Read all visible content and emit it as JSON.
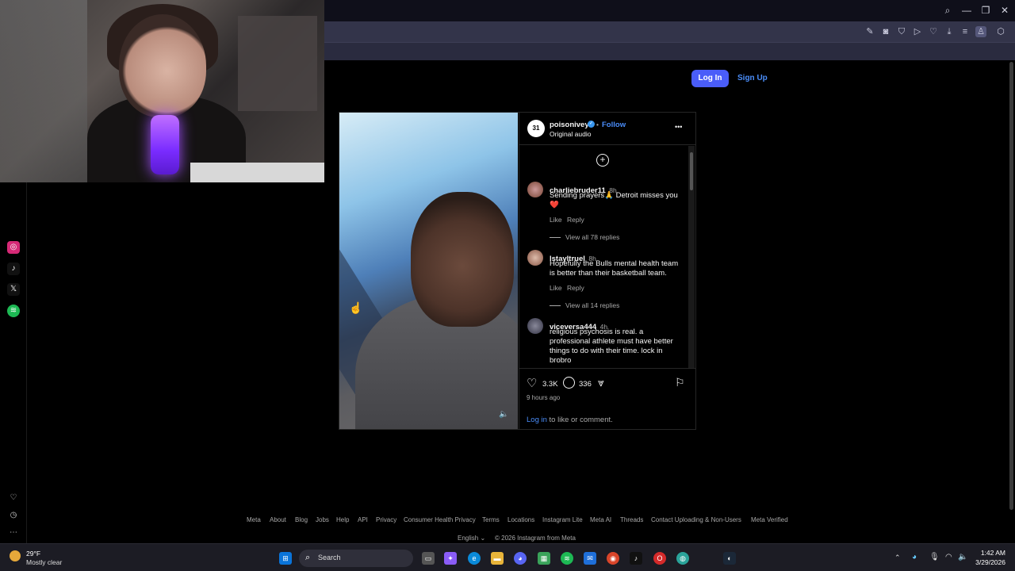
{
  "webcam": {
    "label": "Streamer webcam overlay"
  },
  "browser": {
    "window_controls": [
      "⌕",
      "—",
      "❐",
      "✕"
    ],
    "toolbar_icons": [
      "edit-icon",
      "camera-icon",
      "shield-icon",
      "play-icon",
      "heart-icon",
      "download-icon",
      "menu-icon",
      "profile-icon",
      "extensions-icon"
    ]
  },
  "sidebar": {
    "apps": [
      {
        "name": "instagram",
        "glyph": "◎",
        "color": "#d62976"
      },
      {
        "name": "tiktok",
        "glyph": "♪",
        "color": "#111"
      },
      {
        "name": "x",
        "glyph": "𝕏",
        "color": "#111"
      },
      {
        "name": "spotify",
        "glyph": "≋",
        "color": "#1db954"
      }
    ],
    "bottom": [
      "♡",
      "◷",
      "⋯"
    ]
  },
  "header": {
    "login_label": "Log In",
    "signup_label": "Sign Up"
  },
  "post": {
    "username": "poisonivey",
    "follow_label": "Follow",
    "audio": "Original audio",
    "more": "•••",
    "likes": "3.3K",
    "comments_count": "336",
    "time_ago": "9 hours ago",
    "login_link": "Log in",
    "login_text": " to like or comment.",
    "comments": [
      {
        "user": "charliebruder11",
        "time": "8h",
        "text": "Sending prayers🙏 Detroit misses you ❤️",
        "like": "Like",
        "reply": "Reply",
        "view": "View all 78 replies"
      },
      {
        "user": "lstayltruel",
        "time": "8h",
        "text": "Hopefully the Bulls mental health team is better than their basketball team.",
        "like": "Like",
        "reply": "Reply",
        "view": "View all 14 replies"
      },
      {
        "user": "viceversa444",
        "time": "4h",
        "text": "religious psychosis is real. a professional athlete must have better things to do with their time. lock in brobro"
      }
    ]
  },
  "footer": {
    "links": [
      "Meta",
      "About",
      "Blog",
      "Jobs",
      "Help",
      "API",
      "Privacy",
      "Consumer Health Privacy",
      "Terms",
      "Locations",
      "Instagram Lite",
      "Meta AI",
      "Threads",
      "Contact Uploading & Non-Users",
      "Meta Verified"
    ],
    "language": "English",
    "copyright": "© 2026 Instagram from Meta"
  },
  "taskbar": {
    "weather_temp": "29°F",
    "weather_desc": "Mostly clear",
    "search_label": "Search",
    "time": "1:42 AM",
    "date": "3/29/2026"
  }
}
